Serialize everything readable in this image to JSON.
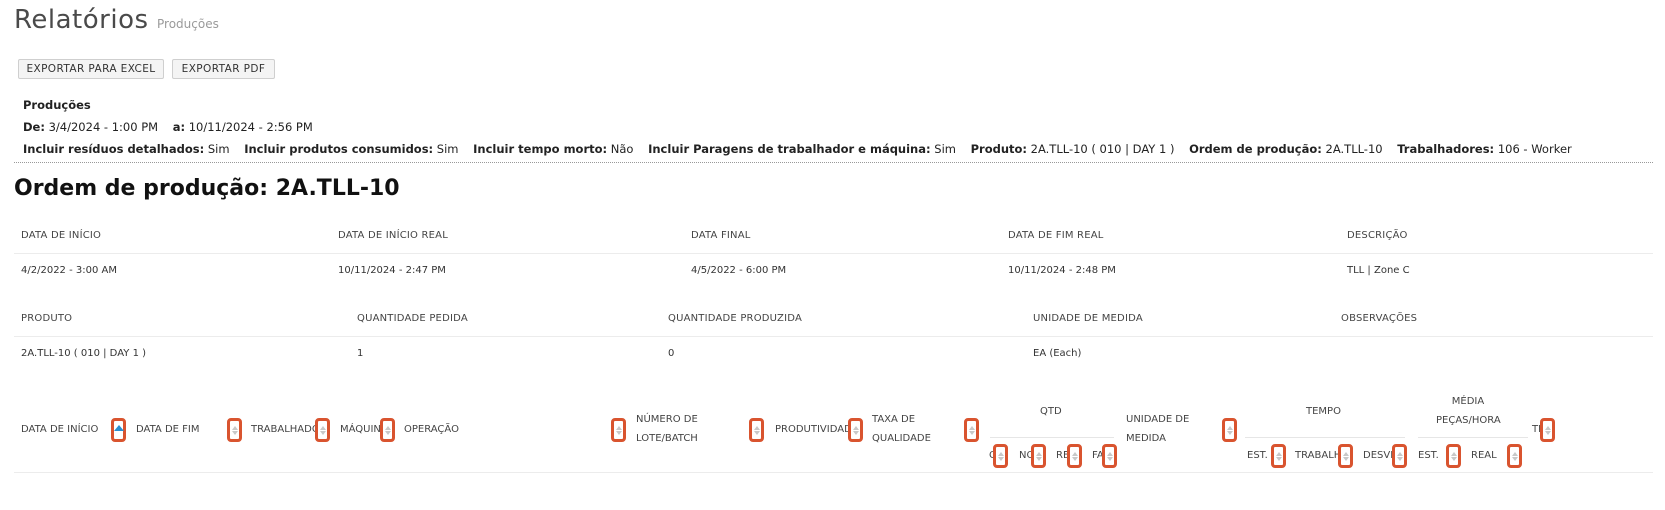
{
  "page": {
    "title": "Relatórios",
    "subtitle": "Produções"
  },
  "actions": {
    "excel": "EXPORTAR PARA EXCEL",
    "pdf": "EXPORTAR PDF"
  },
  "filters": {
    "heading": "Produções",
    "from_label": "De:",
    "from_value": "3/4/2024 - 1:00 PM",
    "to_label": "a:",
    "to_value": "10/11/2024 - 2:56 PM",
    "residues_label": "Incluir resíduos detalhados:",
    "residues_value": "Sim",
    "consumed_label": "Incluir produtos consumidos:",
    "consumed_value": "Sim",
    "deadtime_label": "Incluir tempo morto:",
    "deadtime_value": "Não",
    "stops_label": "Incluir Paragens de trabalhador e máquina:",
    "stops_value": "Sim",
    "product_label": "Produto:",
    "product_value": "2A.TLL-10 ( 010 | DAY 1 )",
    "order_label": "Ordem de produção:",
    "order_value": "2A.TLL-10",
    "workers_label": "Trabalhadores:",
    "workers_value": "106 - Worker"
  },
  "order": {
    "heading": "Ordem de produção: 2A.TLL-10",
    "row1_labels": [
      "DATA DE INÍCIO",
      "DATA DE INÍCIO REAL",
      "DATA FINAL",
      "DATA DE FIM REAL",
      "DESCRIÇÃO"
    ],
    "row1_values": [
      "4/2/2022 - 3:00 AM",
      "10/11/2024 - 2:47 PM",
      "4/5/2022 - 6:00 PM",
      "10/11/2024 - 2:48 PM",
      "TLL | Zone C"
    ],
    "row2_labels": [
      "PRODUTO",
      "QUANTIDADE PEDIDA",
      "QUANTIDADE PRODUZIDA",
      "UNIDADE DE MEDIDA",
      "OBSERVAÇÕES"
    ],
    "row2_values": [
      "2A.TLL-10 ( 010 | DAY 1 )",
      "1",
      "0",
      "EA (Each)",
      ""
    ]
  },
  "table": {
    "start": "DATA DE INÍCIO",
    "end": "DATA DE FIM",
    "worker": "TRABALHADOR",
    "machine": "MÁQUINA",
    "operation": "OPERAÇÃO",
    "lot_1": "NÚMERO DE",
    "lot_2": "LOTE/BATCH",
    "productivity": "PRODUTIVIDADE",
    "quality_1": "TAXA DE",
    "quality_2": "QUALIDADE",
    "qtd": "QTD",
    "ok": "OK",
    "nok": "NOK",
    "rec": "REC.",
    "fat": "FAT.",
    "unit_1": "UNIDADE DE",
    "unit_2": "MEDIDA",
    "time": "TEMPO",
    "est": "EST.",
    "work": "TRABALHO",
    "dev": "DESVIO",
    "avg_1": "MÉDIA",
    "avg_2": "PEÇAS/HORA",
    "avg_est": "EST.",
    "avg_real": "REAL",
    "tll": "TLL"
  }
}
